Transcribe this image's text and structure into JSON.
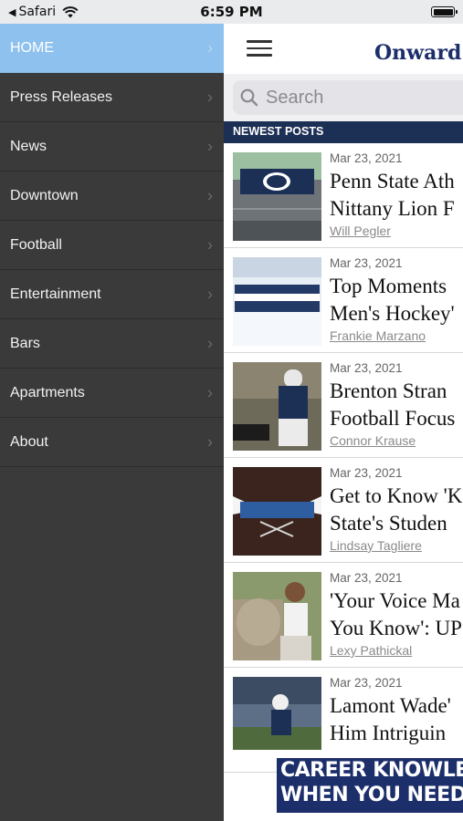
{
  "status_bar": {
    "back_app": "Safari",
    "time": "6:59 PM"
  },
  "menu": {
    "items": [
      {
        "label": "HOME"
      },
      {
        "label": "Press Releases"
      },
      {
        "label": "News"
      },
      {
        "label": "Downtown"
      },
      {
        "label": "Football"
      },
      {
        "label": "Entertainment"
      },
      {
        "label": "Bars"
      },
      {
        "label": "Apartments"
      },
      {
        "label": "About"
      }
    ]
  },
  "header": {
    "brand": "Onward State"
  },
  "search": {
    "placeholder": "Search"
  },
  "section_title": "NEWEST POSTS",
  "posts": [
    {
      "date": "Mar 23, 2021",
      "title_line1": "Penn State Ath",
      "title_line2": "Nittany Lion F",
      "author": "Will Pegler"
    },
    {
      "date": "Mar 23, 2021",
      "title_line1": "Top Moments",
      "title_line2": "Men's Hockey'",
      "author": "Frankie Marzano"
    },
    {
      "date": "Mar 23, 2021",
      "title_line1": "Brenton Stran",
      "title_line2": "Football Focus",
      "author": "Connor Krause"
    },
    {
      "date": "Mar 23, 2021",
      "title_line1": "Get to Know 'K",
      "title_line2": "State's Studen",
      "author": "Lindsay Tagliere"
    },
    {
      "date": "Mar 23, 2021",
      "title_line1": "'Your Voice Ma",
      "title_line2": "You Know': UP",
      "author": "Lexy Pathickal"
    },
    {
      "date": "Mar 23, 2021",
      "title_line1": "Lamont Wade'",
      "title_line2": "Him Intriguin",
      "author": ""
    }
  ],
  "ad": {
    "line1": "CAREER KNOWLE",
    "line2": "WHEN YOU NEED"
  },
  "colors": {
    "accent": "#8ec1ee",
    "navy": "#1c2f55",
    "drawer": "#3a3a3a"
  }
}
